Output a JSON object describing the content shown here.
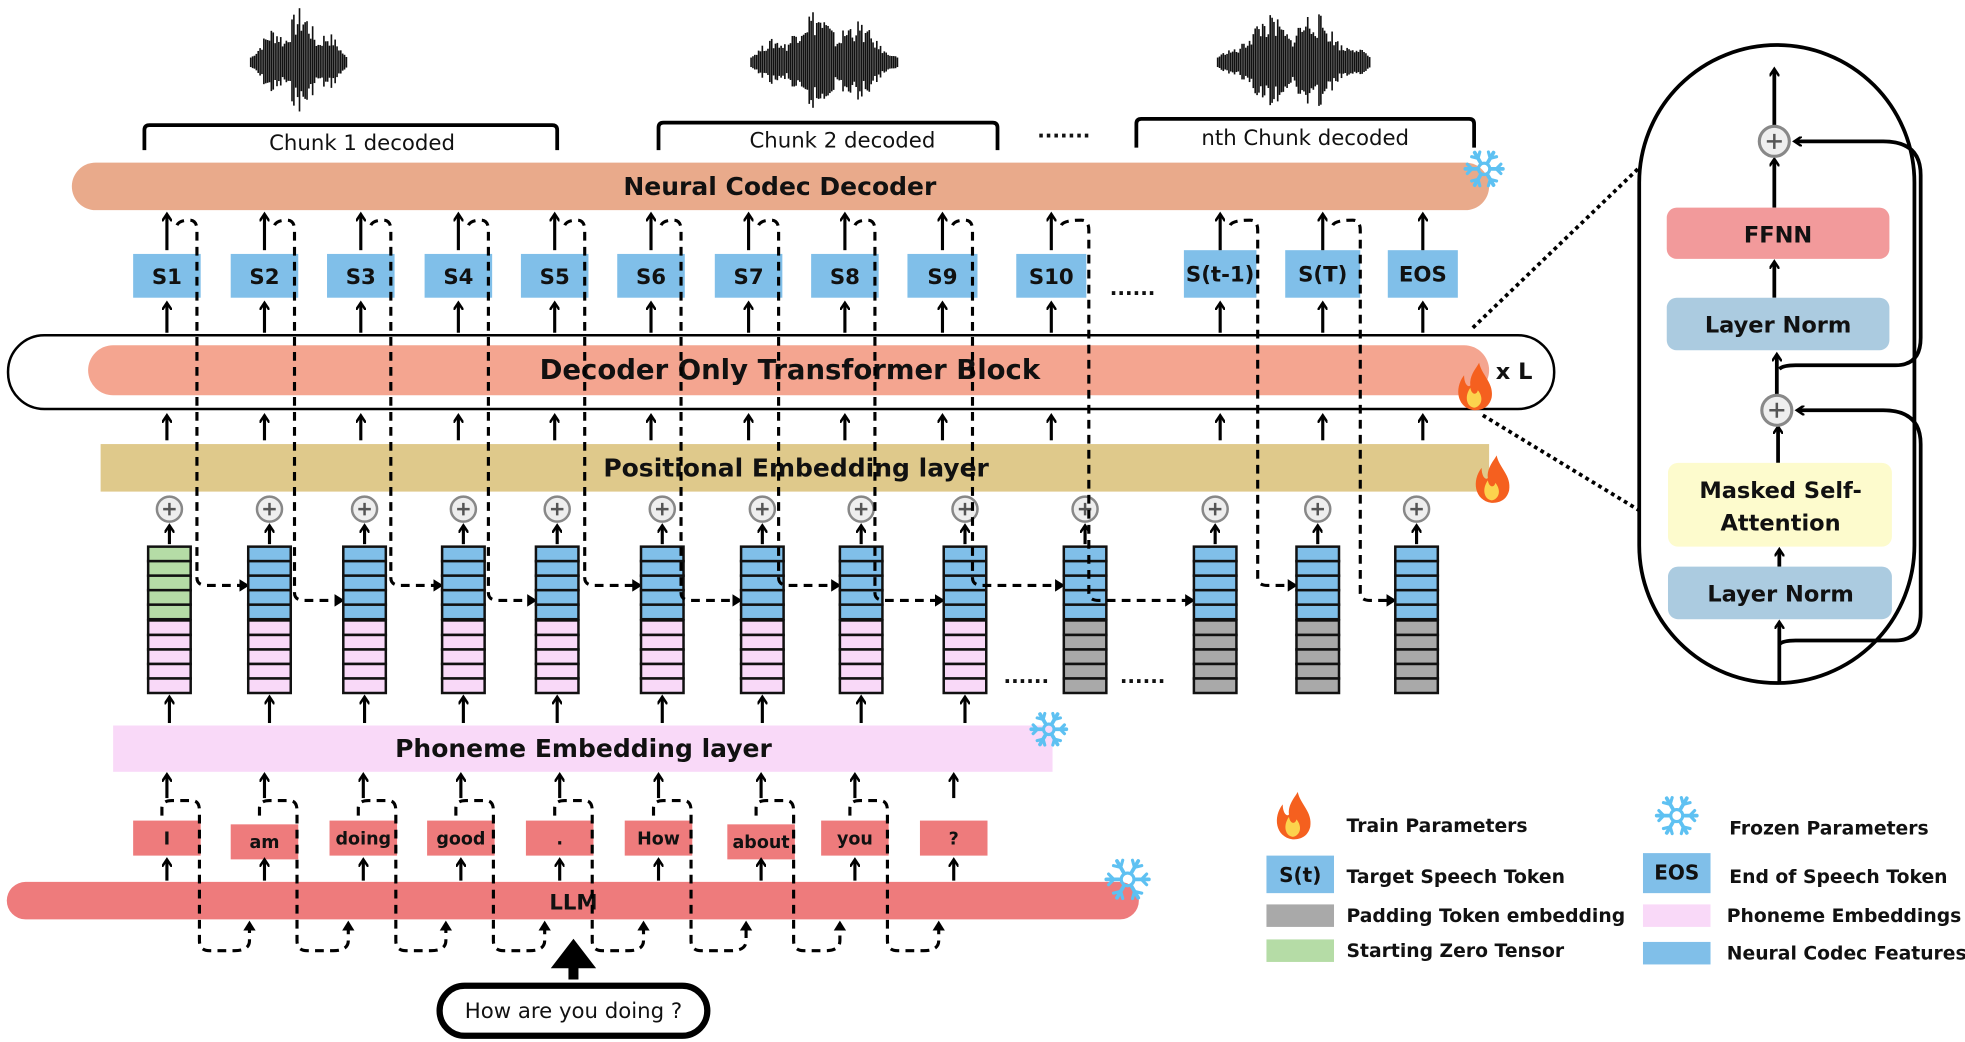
{
  "chunks": [
    "Chunk 1 decoded",
    "Chunk 2 decoded",
    "nth Chunk decoded"
  ],
  "chunk_ellipsis": ".......",
  "neural_codec_decoder": "Neural Codec Decoder",
  "speech_tokens": [
    "S1",
    "S2",
    "S3",
    "S4",
    "S5",
    "S6",
    "S7",
    "S8",
    "S9",
    "S10",
    "S(t-1)",
    "S(T)",
    "EOS"
  ],
  "token_ellipsis": "......",
  "decoder_block": "Decoder Only Transformer Block",
  "repeat_label": "x L",
  "positional_embedding": "Positional Embedding layer",
  "stack_ellipsis": "......",
  "phoneme_embedding": "Phoneme Embedding layer",
  "words": [
    "I",
    "am",
    "doing",
    "good",
    ".",
    "How",
    "about",
    "you",
    "?"
  ],
  "llm": "LLM",
  "prompt": "How are you doing ?",
  "transformer_detail": {
    "ffnn": "FFNN",
    "layer_norm_top": "Layer Norm",
    "attention_line1": "Masked Self-",
    "attention_line2": "Attention",
    "layer_norm_bottom": "Layer Norm"
  },
  "legend": {
    "train": "Train Parameters",
    "frozen": "Frozen Parameters",
    "st_badge": "S(t)",
    "st": "Target Speech Token",
    "eos_badge": "EOS",
    "eos": "End of Speech Token",
    "padding": "Padding Token embedding",
    "phoneme": "Phoneme Embeddings",
    "zero": "Starting Zero Tensor",
    "codec": "Neural Codec Features"
  },
  "icons": {
    "train": "fire-icon",
    "frozen": "snowflake-icon"
  },
  "colors": {
    "decoder": "#e9aa8b",
    "transformer": "#f4a590",
    "positional": "#dfc98b",
    "phoneme": "#f9d9f8",
    "llm": "#ee7b7c",
    "token": "#80bfe9",
    "padding": "#a9a9a9",
    "zero": "#b5dca6",
    "ffnn": "#f29a9b",
    "layernorm": "#abcbe0",
    "attention": "#fdfbcd"
  }
}
